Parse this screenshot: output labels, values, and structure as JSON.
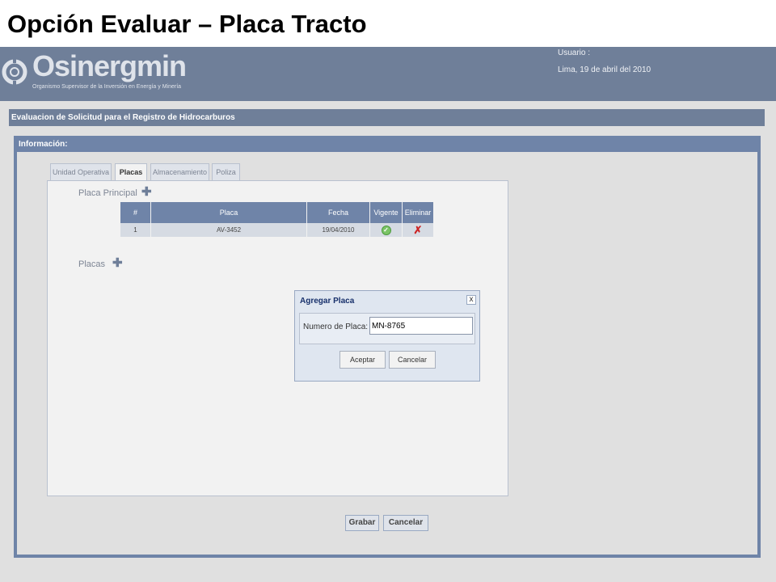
{
  "slide": {
    "title": "Opción Evaluar – Placa Tracto"
  },
  "header": {
    "logo_name": "Osinergmin",
    "logo_subtitle": "Organismo Supervisor de la Inversión en Energía y Minería",
    "user_label": "Usuario :",
    "date_text": "Lima, 19 de abril del 2010"
  },
  "page": {
    "section_title": "Evaluacion de Solicitud para el Registro de Hidrocarburos",
    "info_title": "Información:"
  },
  "tabs": [
    {
      "label": "Unidad Operativa",
      "active": false
    },
    {
      "label": "Placas",
      "active": true
    },
    {
      "label": "Almacenamiento",
      "active": false
    },
    {
      "label": "Poliza",
      "active": false
    }
  ],
  "placa_principal": {
    "label": "Placa Principal",
    "columns": [
      "#",
      "Placa",
      "Fecha",
      "Vigente",
      "Eliminar"
    ],
    "rows": [
      {
        "num": "1",
        "placa": "AV-3452",
        "fecha": "19/04/2010",
        "vigente": "check-icon",
        "eliminar": "delete-icon"
      }
    ]
  },
  "placas": {
    "label": "Placas"
  },
  "dialog": {
    "title": "Agregar Placa",
    "close_glyph": "x",
    "field_label": "Numero de Placa:",
    "field_value": "MN-8765",
    "accept_label": "Aceptar",
    "cancel_label": "Cancelar"
  },
  "footer": {
    "save_label": "Grabar",
    "cancel_label": "Cancelar"
  },
  "colors": {
    "header_bg": "#6f7f99",
    "panel_border": "#6f84a8",
    "grid_header": "#6f84a8"
  }
}
